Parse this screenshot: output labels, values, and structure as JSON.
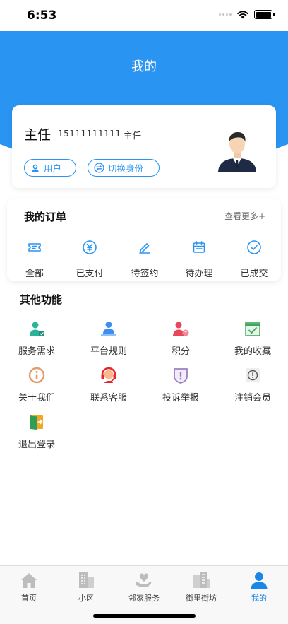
{
  "status_bar": {
    "time": "6:53"
  },
  "header": {
    "title": "我的"
  },
  "profile": {
    "name": "主任",
    "phone": "15111111111",
    "role": "主任",
    "user_button": "用户",
    "switch_button": "切换身份"
  },
  "orders": {
    "title": "我的订单",
    "more": "查看更多+",
    "items": [
      {
        "label": "全部",
        "icon": "ticket-icon"
      },
      {
        "label": "已支付",
        "icon": "yen-icon"
      },
      {
        "label": "待签约",
        "icon": "pen-icon"
      },
      {
        "label": "待办理",
        "icon": "calendar-icon"
      },
      {
        "label": "已成交",
        "icon": "check-circle-icon"
      }
    ]
  },
  "other": {
    "title": "其他功能",
    "items": [
      {
        "label": "服务需求",
        "icon": "service-person-icon"
      },
      {
        "label": "平台规则",
        "icon": "rules-person-icon"
      },
      {
        "label": "积分",
        "icon": "points-person-icon"
      },
      {
        "label": "我的收藏",
        "icon": "favorites-store-icon"
      },
      {
        "label": "关于我们",
        "icon": "info-icon"
      },
      {
        "label": "联系客服",
        "icon": "headset-icon"
      },
      {
        "label": "投诉举报",
        "icon": "complaint-shield-icon"
      },
      {
        "label": "注销会员",
        "icon": "cancel-membership-icon"
      },
      {
        "label": "退出登录",
        "icon": "logout-door-icon"
      }
    ]
  },
  "tabbar": {
    "items": [
      {
        "label": "首页",
        "icon": "home-icon"
      },
      {
        "label": "小区",
        "icon": "building-icon"
      },
      {
        "label": "邻家服务",
        "icon": "heart-hand-icon"
      },
      {
        "label": "街里街坊",
        "icon": "buildings-icon"
      },
      {
        "label": "我的",
        "icon": "person-icon"
      }
    ],
    "active": "我的"
  },
  "colors": {
    "accent": "#2a94f2",
    "tab_active": "#1a87e6",
    "tab_inactive": "#bdbdbd"
  }
}
